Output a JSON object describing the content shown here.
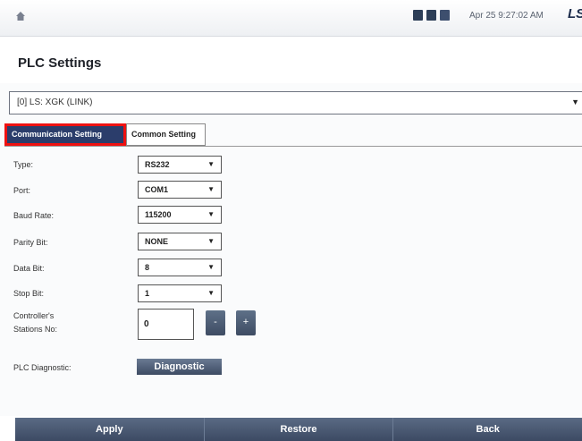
{
  "header": {
    "datetime": "Apr 25 9:27:02 AM",
    "logo": "LS"
  },
  "page": {
    "title": "PLC Settings"
  },
  "plc_select": {
    "value": "[0] LS: XGK (LINK)"
  },
  "tabs": [
    {
      "label": "Communication Setting",
      "active": true
    },
    {
      "label": "Common Setting",
      "active": false
    }
  ],
  "fields": {
    "type": {
      "label": "Type:",
      "value": "RS232"
    },
    "port": {
      "label": "Port:",
      "value": "COM1"
    },
    "baud": {
      "label": "Baud Rate:",
      "value": "115200"
    },
    "parity": {
      "label": "Parity Bit:",
      "value": "NONE"
    },
    "databit": {
      "label": "Data Bit:",
      "value": "8"
    },
    "stopbit": {
      "label": "Stop Bit:",
      "value": "1"
    },
    "station": {
      "label_line1": "Controller's",
      "label_line2": "Stations No:",
      "value": "0"
    },
    "diagnostic": {
      "label": "PLC Diagnostic:",
      "button": "Diagnostic"
    }
  },
  "stepper": {
    "minus": "-",
    "plus": "+"
  },
  "footer": {
    "apply": "Apply",
    "restore": "Restore",
    "back": "Back"
  },
  "colors": {
    "highlight": "#e11111",
    "active_tab": "#2b3d6b",
    "button": "#3e4c63"
  }
}
